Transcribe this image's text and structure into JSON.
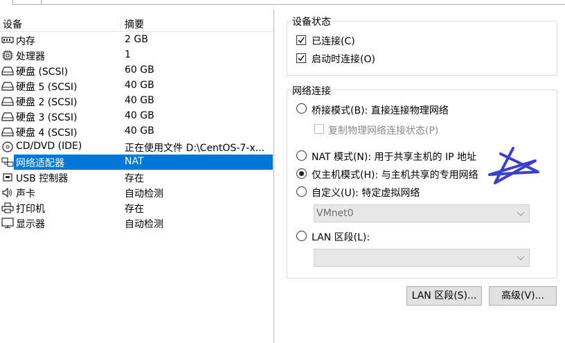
{
  "device_list": {
    "header": {
      "device": "设备",
      "summary": "摘要"
    },
    "rows": [
      {
        "icon": "memory-icon",
        "name": "内存",
        "summary": "2 GB",
        "selected": false
      },
      {
        "icon": "processor-icon",
        "name": "处理器",
        "summary": "1",
        "selected": false
      },
      {
        "icon": "hard-disk-icon",
        "name": "硬盘 (SCSI)",
        "summary": "60 GB",
        "selected": false
      },
      {
        "icon": "hard-disk-icon",
        "name": "硬盘 5 (SCSI)",
        "summary": "40 GB",
        "selected": false
      },
      {
        "icon": "hard-disk-icon",
        "name": "硬盘 2 (SCSI)",
        "summary": "40 GB",
        "selected": false
      },
      {
        "icon": "hard-disk-icon",
        "name": "硬盘 3 (SCSI)",
        "summary": "40 GB",
        "selected": false
      },
      {
        "icon": "hard-disk-icon",
        "name": "硬盘 4 (SCSI)",
        "summary": "40 GB",
        "selected": false
      },
      {
        "icon": "cd-dvd-icon",
        "name": "CD/DVD (IDE)",
        "summary": "正在使用文件 D:\\CentOS-7-x...",
        "selected": false
      },
      {
        "icon": "network-adapter-icon",
        "name": "网络适配器",
        "summary": "NAT",
        "selected": true
      },
      {
        "icon": "usb-icon",
        "name": "USB 控制器",
        "summary": "存在",
        "selected": false
      },
      {
        "icon": "sound-card-icon",
        "name": "声卡",
        "summary": "自动检测",
        "selected": false
      },
      {
        "icon": "printer-icon",
        "name": "打印机",
        "summary": "存在",
        "selected": false
      },
      {
        "icon": "display-icon",
        "name": "显示器",
        "summary": "自动检测",
        "selected": false
      }
    ]
  },
  "device_status": {
    "title": "设备状态",
    "connected": {
      "label": "已连接(C)",
      "checked": true
    },
    "connect_at_power_on": {
      "label": "启动时连接(O)",
      "checked": true
    }
  },
  "network_connection": {
    "title": "网络连接",
    "bridged": {
      "label": "桥接模式(B): 直接连接物理网络",
      "selected": false
    },
    "replicate_state": {
      "label": "复制物理网络连接状态(P)",
      "checked": false,
      "disabled": true
    },
    "nat": {
      "label": "NAT 模式(N): 用于共享主机的 IP 地址",
      "selected": false
    },
    "host_only": {
      "label": "仅主机模式(H): 与主机共享的专用网络",
      "selected": true
    },
    "custom": {
      "label": "自定义(U): 特定虚拟网络",
      "selected": false
    },
    "custom_network_value": "VMnet0",
    "lan_segment": {
      "label": "LAN 区段(L):",
      "selected": false
    },
    "lan_segment_value": ""
  },
  "buttons": {
    "lan_segments": "LAN 区段(S)...",
    "advanced": "高级(V)..."
  },
  "annotation": {
    "color": "#3b3fcf",
    "shape": "star-scribble"
  },
  "colors": {
    "selection": "#0078d7",
    "button_bg": "#e1e1e1",
    "disabled_text": "#8a8a8a"
  }
}
